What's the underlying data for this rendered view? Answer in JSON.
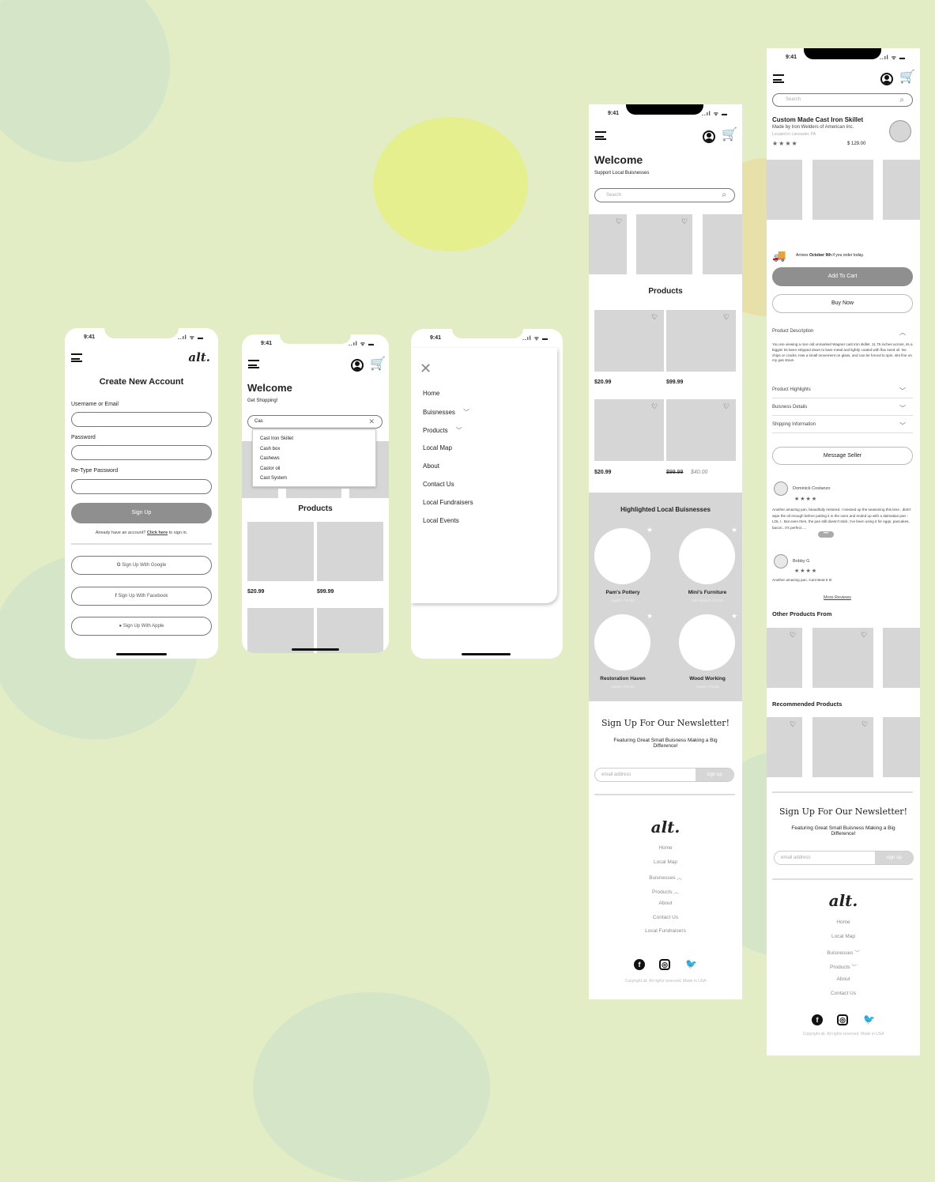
{
  "status_time": "9:41",
  "status_icons": "..ıl ᯤ ▬",
  "logo": "alt.",
  "create_account": {
    "title": "Create New Account",
    "username_label": "Username or Email",
    "password_label": "Password",
    "retype_label": "Re-Type Password",
    "signup_button": "Sign Up",
    "already_text": "Already have an account?",
    "click_here": "Click here",
    "sign_in_text": "to sign in.",
    "google": "Sign Up With Google",
    "facebook": "Sign Up With Facebook",
    "apple": "Sign Up With Apple"
  },
  "search_screen": {
    "welcome": "Welcome",
    "subtitle": "Get Shopping!",
    "search_value": "Cas",
    "suggestions": [
      "Cast Iron Skillet",
      "Cash box",
      "Cashews",
      "Castor oil",
      "Cast System"
    ],
    "products_title": "Products",
    "prices": [
      "$20.99",
      "$99.99"
    ]
  },
  "menu_screen": {
    "close": "✕",
    "items": [
      "Home",
      "Buisnesses",
      "Products",
      "Local Map",
      "About",
      "Contact Us",
      "Local Fundraisers",
      "Local Events"
    ]
  },
  "home_screen": {
    "welcome": "Welcome",
    "subtitle": "Support Local Buisnesses",
    "search_placeholder": "Search",
    "products_title": "Products",
    "prices_row1": [
      "$20.99",
      "$99.99"
    ],
    "prices_row2_first": "$20.99",
    "old_price": "$99.99",
    "sale_price": "$40.00",
    "highlighted_title": "Highlighted Local Buisnesses",
    "businesses": [
      {
        "name": "Pam's Pottery",
        "location": "Jupiter, Florida"
      },
      {
        "name": "Mini's Furniture",
        "location": "Palm Beach, Florida"
      },
      {
        "name": "Restoration Haven",
        "location": "Jupiter, Florida"
      },
      {
        "name": "Wood Working",
        "location": "Jupiter, Florida"
      }
    ],
    "newsletter_title": "Sign Up For Our Newsletter!",
    "newsletter_sub": "Featuring Great Small Buisness Making a Big Difference!",
    "email_placeholder": "email address",
    "signup_small": "sign up",
    "footer_links": [
      "Home",
      "Local Map",
      "Buisnesses",
      "Products",
      "About",
      "Contact Us",
      "Local Fundraisers"
    ],
    "copyright": "Copyright alt. All rights reserved. Made in USA"
  },
  "product_screen": {
    "search_placeholder": "Search",
    "title": "Custom Made Cast Iron Skillet",
    "made_by": "Made by Iron Welders of American Inc.",
    "located": "Located in Lancaster, PA",
    "price": "$ 129.00",
    "arrives_prefix": "Arrives",
    "arrives_date": "October 9th",
    "arrives_suffix": "if you order today.",
    "add_to_cart": "Add To Cart",
    "buy_now": "Buy Now",
    "desc_title": "Product Description",
    "desc_text": "You are viewing a nice old unmarked Wagner cast iron skillet. 11.75 inches across, its a biggin! Its been stripped down to bare metal and lightly coated with flax seed oil. No chips or cracks. Has a small movement on glass, and can be forced to spin, sits fine on my gas stove.",
    "highlights": "Product Highlights",
    "business_details": "Buisness Details",
    "shipping": "Shipping Information",
    "message_seller": "Message Seller",
    "review1_name": "Dominick Costanzo",
    "review1_text": "Another amazing pan, beautifully restored. I messed up the seasoning this time : didn't wipe the oil enough before putting it in the oven and ended up with a dalmatian pan - LOL !.. But even then, the pan still doesn't stick. I've been using it for eggs, pancakes, bacon.. it's perfect.....",
    "review2_name": "Bobby G",
    "review2_text": "Another amazing pan. Cant Beat It It!",
    "more_reviews": "More Reviews",
    "other_products": "Other Products From",
    "recommended": "Recommended Products",
    "newsletter_title": "Sign Up For Our Newsletter!",
    "newsletter_sub": "Featuring Great Small Buisness Making a Big Difference!",
    "email_placeholder": "email address",
    "signup_small": "sign up",
    "footer_links": [
      "Home",
      "Local Map",
      "Buisnesses",
      "Products",
      "About",
      "Contact Us"
    ],
    "copyright": "Copyright alt. All rights reserved. Made in USA"
  },
  "colors": {
    "background": "#e2ecc5",
    "placeholder_gray": "#d6d6d6",
    "button_gray": "#8f8f8f"
  }
}
